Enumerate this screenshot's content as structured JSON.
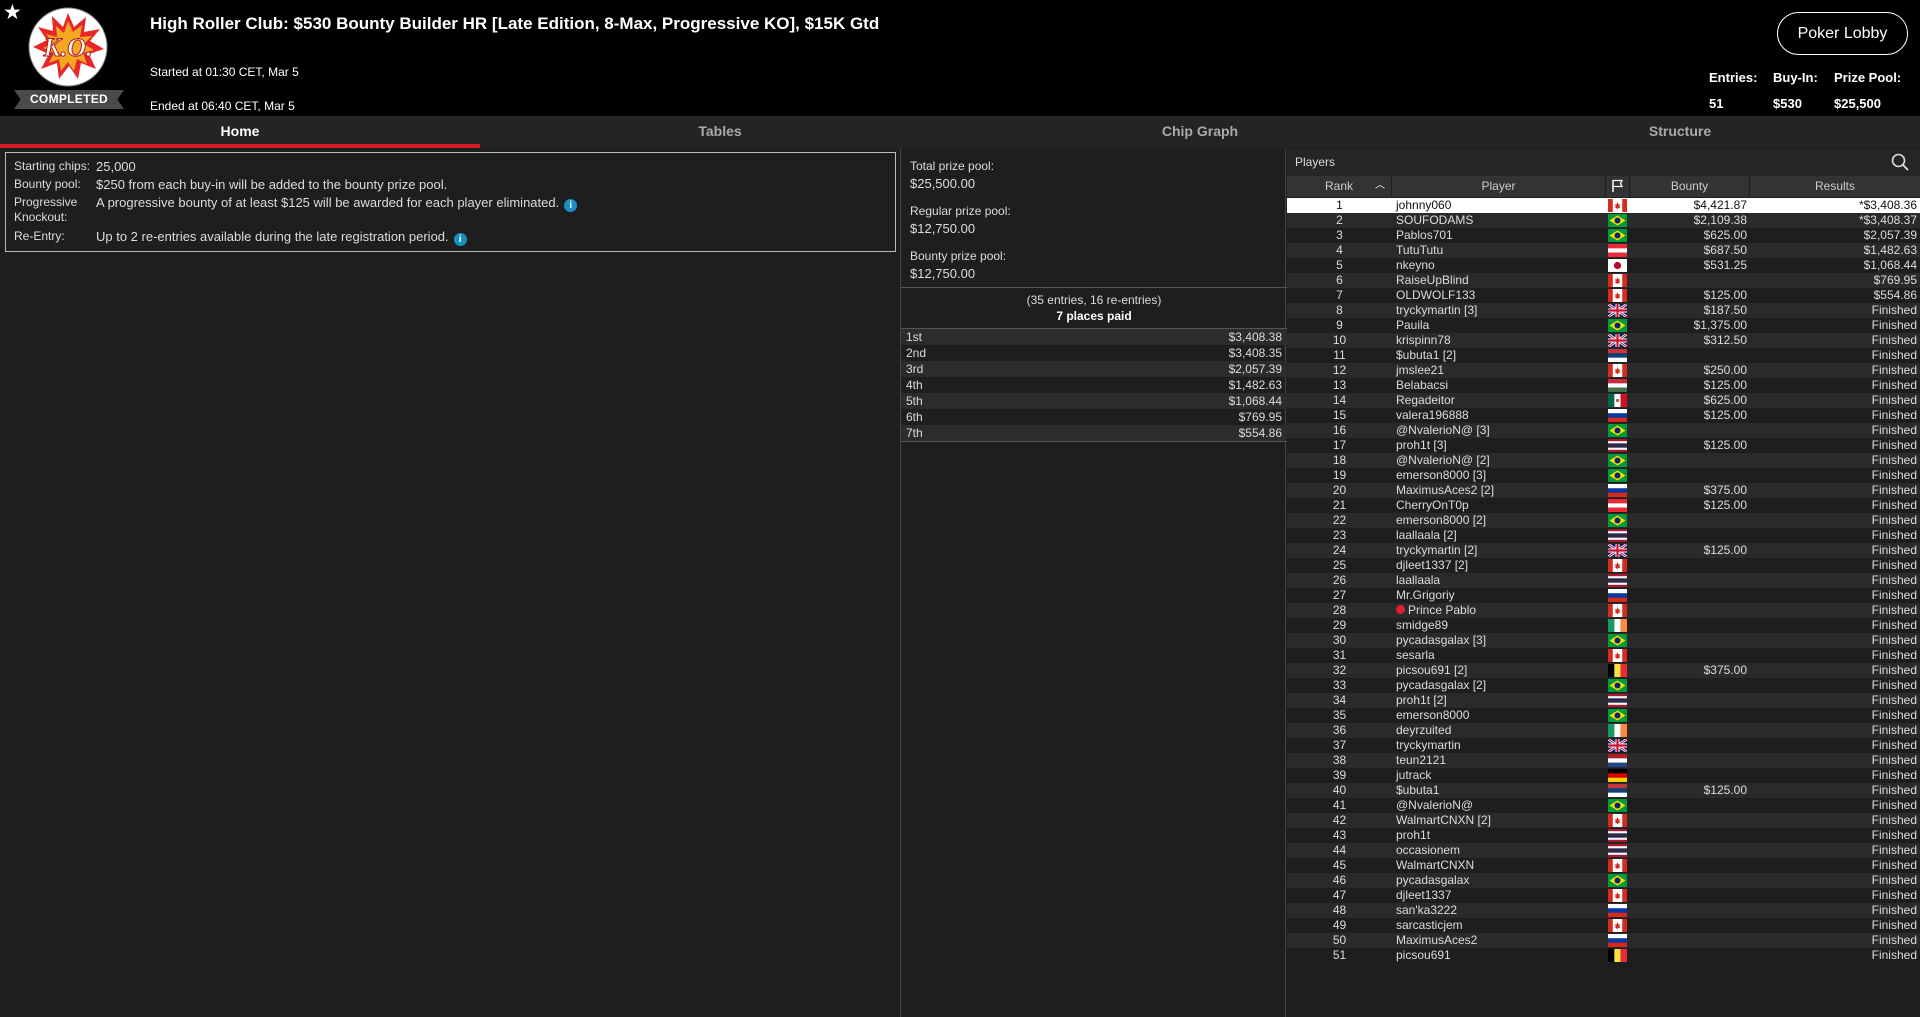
{
  "header": {
    "logo_text": "K.O.",
    "status": "COMPLETED",
    "title": "High Roller Club: $530 Bounty Builder HR [Late Edition, 8-Max, Progressive KO], $15K Gtd",
    "started": "Started at 01:30 CET, Mar 5",
    "ended": "Ended at 06:40 CET, Mar 5",
    "lobby_button": "Poker Lobby",
    "entries_label": "Entries:",
    "entries_value": "51",
    "buyin_label": "Buy-In:",
    "buyin_value": "$530",
    "prize_label": "Prize Pool:",
    "prize_value": "$25,500"
  },
  "tabs": [
    "Home",
    "Tables",
    "Chip Graph",
    "Structure"
  ],
  "info": {
    "starting_chips_label": "Starting chips:",
    "starting_chips": "25,000",
    "bounty_pool_label": "Bounty pool:",
    "bounty_pool": "$250 from each buy-in will be added to the bounty prize pool.",
    "pko_label": "Progressive Knockout:",
    "pko": "A progressive bounty of at least $125 will be awarded for each player eliminated.",
    "reentry_label": "Re-Entry:",
    "reentry": "Up to 2 re-entries available during the late registration period."
  },
  "pools": {
    "total_label": "Total prize pool:",
    "total": "$25,500.00",
    "regular_label": "Regular prize pool:",
    "regular": "$12,750.00",
    "bounty_label": "Bounty prize pool:",
    "bounty": "$12,750.00",
    "entries_note": "(35 entries, 16 re-entries)",
    "places_note": "7 places paid"
  },
  "payouts": [
    {
      "place": "1st",
      "amount": "$3,408.38"
    },
    {
      "place": "2nd",
      "amount": "$3,408.35"
    },
    {
      "place": "3rd",
      "amount": "$2,057.39"
    },
    {
      "place": "4th",
      "amount": "$1,482.63"
    },
    {
      "place": "5th",
      "amount": "$1,068.44"
    },
    {
      "place": "6th",
      "amount": "$769.95"
    },
    {
      "place": "7th",
      "amount": "$554.86"
    }
  ],
  "players_panel": {
    "title": "Players",
    "col_rank": "Rank",
    "col_player": "Player",
    "col_bounty": "Bounty",
    "col_results": "Results"
  },
  "players": [
    {
      "rank": "1",
      "name": "johnny060",
      "flag": "ca",
      "bounty": "$4,421.87",
      "result": "*$3,408.36"
    },
    {
      "rank": "2",
      "name": "SOUFODAMS",
      "flag": "br",
      "bounty": "$2,109.38",
      "result": "*$3,408.37"
    },
    {
      "rank": "3",
      "name": "Pablos701",
      "flag": "br",
      "bounty": "$625.00",
      "result": "$2,057.39"
    },
    {
      "rank": "4",
      "name": "TutuTutu",
      "flag": "at",
      "bounty": "$687.50",
      "result": "$1,482.63"
    },
    {
      "rank": "5",
      "name": "nkeyno",
      "flag": "jp",
      "bounty": "$531.25",
      "result": "$1,068.44"
    },
    {
      "rank": "6",
      "name": "RaiseUpBlind",
      "flag": "ca",
      "bounty": "",
      "result": "$769.95"
    },
    {
      "rank": "7",
      "name": "OLDWOLF133",
      "flag": "ca",
      "bounty": "$125.00",
      "result": "$554.86"
    },
    {
      "rank": "8",
      "name": "tryckymartin [3]",
      "flag": "gb",
      "bounty": "$187.50",
      "result": "Finished"
    },
    {
      "rank": "9",
      "name": "Pauila",
      "flag": "br",
      "bounty": "$1,375.00",
      "result": "Finished"
    },
    {
      "rank": "10",
      "name": "krispinn78",
      "flag": "gb",
      "bounty": "$312.50",
      "result": "Finished"
    },
    {
      "rank": "11",
      "name": "$ubuta1 [2]",
      "flag": "rs",
      "bounty": "",
      "result": "Finished"
    },
    {
      "rank": "12",
      "name": "jmslee21",
      "flag": "ca",
      "bounty": "$250.00",
      "result": "Finished"
    },
    {
      "rank": "13",
      "name": "Belabacsi",
      "flag": "hu",
      "bounty": "$125.00",
      "result": "Finished"
    },
    {
      "rank": "14",
      "name": "Regadeitor",
      "flag": "mx",
      "bounty": "$625.00",
      "result": "Finished"
    },
    {
      "rank": "15",
      "name": "valera196888",
      "flag": "ru",
      "bounty": "$125.00",
      "result": "Finished"
    },
    {
      "rank": "16",
      "name": "@NvalerioN@ [3]",
      "flag": "br",
      "bounty": "",
      "result": "Finished"
    },
    {
      "rank": "17",
      "name": "proh1t [3]",
      "flag": "th",
      "bounty": "$125.00",
      "result": "Finished"
    },
    {
      "rank": "18",
      "name": "@NvalerioN@ [2]",
      "flag": "br",
      "bounty": "",
      "result": "Finished"
    },
    {
      "rank": "19",
      "name": "emerson8000 [3]",
      "flag": "br",
      "bounty": "",
      "result": "Finished"
    },
    {
      "rank": "20",
      "name": "MaximusAces2 [2]",
      "flag": "ru",
      "bounty": "$375.00",
      "result": "Finished"
    },
    {
      "rank": "21",
      "name": "CherryOnT0p",
      "flag": "at",
      "bounty": "$125.00",
      "result": "Finished"
    },
    {
      "rank": "22",
      "name": "emerson8000 [2]",
      "flag": "br",
      "bounty": "",
      "result": "Finished"
    },
    {
      "rank": "23",
      "name": "laallaala [2]",
      "flag": "th",
      "bounty": "",
      "result": "Finished"
    },
    {
      "rank": "24",
      "name": "tryckymartin [2]",
      "flag": "gb",
      "bounty": "$125.00",
      "result": "Finished"
    },
    {
      "rank": "25",
      "name": "djleet1337 [2]",
      "flag": "ca",
      "bounty": "",
      "result": "Finished"
    },
    {
      "rank": "26",
      "name": "laallaala",
      "flag": "th",
      "bounty": "",
      "result": "Finished"
    },
    {
      "rank": "27",
      "name": "Mr.Grigoriy",
      "flag": "ru",
      "bounty": "",
      "result": "Finished"
    },
    {
      "rank": "28",
      "name": "Prince Pablo",
      "flag": "ca",
      "bounty": "",
      "result": "Finished",
      "badge": true
    },
    {
      "rank": "29",
      "name": "smidge89",
      "flag": "ie",
      "bounty": "",
      "result": "Finished"
    },
    {
      "rank": "30",
      "name": "pycadasgalax [3]",
      "flag": "br",
      "bounty": "",
      "result": "Finished"
    },
    {
      "rank": "31",
      "name": "sesarla",
      "flag": "ca",
      "bounty": "",
      "result": "Finished"
    },
    {
      "rank": "32",
      "name": "picsou691 [2]",
      "flag": "be",
      "bounty": "$375.00",
      "result": "Finished"
    },
    {
      "rank": "33",
      "name": "pycadasgalax [2]",
      "flag": "br",
      "bounty": "",
      "result": "Finished"
    },
    {
      "rank": "34",
      "name": "proh1t [2]",
      "flag": "th",
      "bounty": "",
      "result": "Finished"
    },
    {
      "rank": "35",
      "name": "emerson8000",
      "flag": "br",
      "bounty": "",
      "result": "Finished"
    },
    {
      "rank": "36",
      "name": "deyrzuited",
      "flag": "ie",
      "bounty": "",
      "result": "Finished"
    },
    {
      "rank": "37",
      "name": "tryckymartin",
      "flag": "gb",
      "bounty": "",
      "result": "Finished"
    },
    {
      "rank": "38",
      "name": "teun2121",
      "flag": "nl",
      "bounty": "",
      "result": "Finished"
    },
    {
      "rank": "39",
      "name": "jutrack",
      "flag": "de",
      "bounty": "",
      "result": "Finished"
    },
    {
      "rank": "40",
      "name": "$ubuta1",
      "flag": "rs",
      "bounty": "$125.00",
      "result": "Finished"
    },
    {
      "rank": "41",
      "name": "@NvalerioN@",
      "flag": "br",
      "bounty": "",
      "result": "Finished"
    },
    {
      "rank": "42",
      "name": "WalmartCNXN [2]",
      "flag": "ca",
      "bounty": "",
      "result": "Finished"
    },
    {
      "rank": "43",
      "name": "proh1t",
      "flag": "th",
      "bounty": "",
      "result": "Finished"
    },
    {
      "rank": "44",
      "name": "occasionem",
      "flag": "th",
      "bounty": "",
      "result": "Finished"
    },
    {
      "rank": "45",
      "name": "WalmartCNXN",
      "flag": "ca",
      "bounty": "",
      "result": "Finished"
    },
    {
      "rank": "46",
      "name": "pycadasgalax",
      "flag": "br",
      "bounty": "",
      "result": "Finished"
    },
    {
      "rank": "47",
      "name": "djleet1337",
      "flag": "ca",
      "bounty": "",
      "result": "Finished"
    },
    {
      "rank": "48",
      "name": "san'ka3222",
      "flag": "ru",
      "bounty": "",
      "result": "Finished"
    },
    {
      "rank": "49",
      "name": "sarcasticjem",
      "flag": "ca",
      "bounty": "",
      "result": "Finished"
    },
    {
      "rank": "50",
      "name": "MaximusAces2",
      "flag": "ru",
      "bounty": "",
      "result": "Finished"
    },
    {
      "rank": "51",
      "name": "picsou691",
      "flag": "be",
      "bounty": "",
      "result": "Finished"
    }
  ],
  "colors": {
    "accent_red": "#d51c2b",
    "info_blue": "#1a8fc4",
    "background": "#1e1e1e",
    "header_bg": "#000000"
  }
}
